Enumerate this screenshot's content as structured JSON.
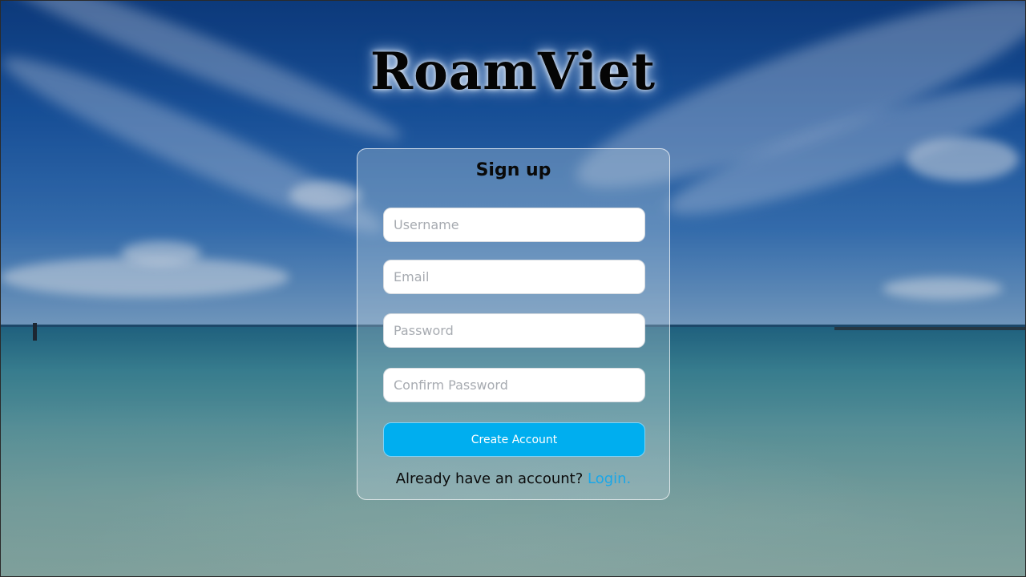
{
  "app": {
    "logo_text": "RoamViet"
  },
  "signup": {
    "title": "Sign up",
    "username_placeholder": "Username",
    "email_placeholder": "Email",
    "password_placeholder": "Password",
    "confirm_password_placeholder": "Confirm Password",
    "create_button_label": "Create Account",
    "footer_prompt": "Already have an account?",
    "login_link_label": "Login."
  },
  "colors": {
    "accent": "#00aeef",
    "link": "#1aa7e8"
  }
}
